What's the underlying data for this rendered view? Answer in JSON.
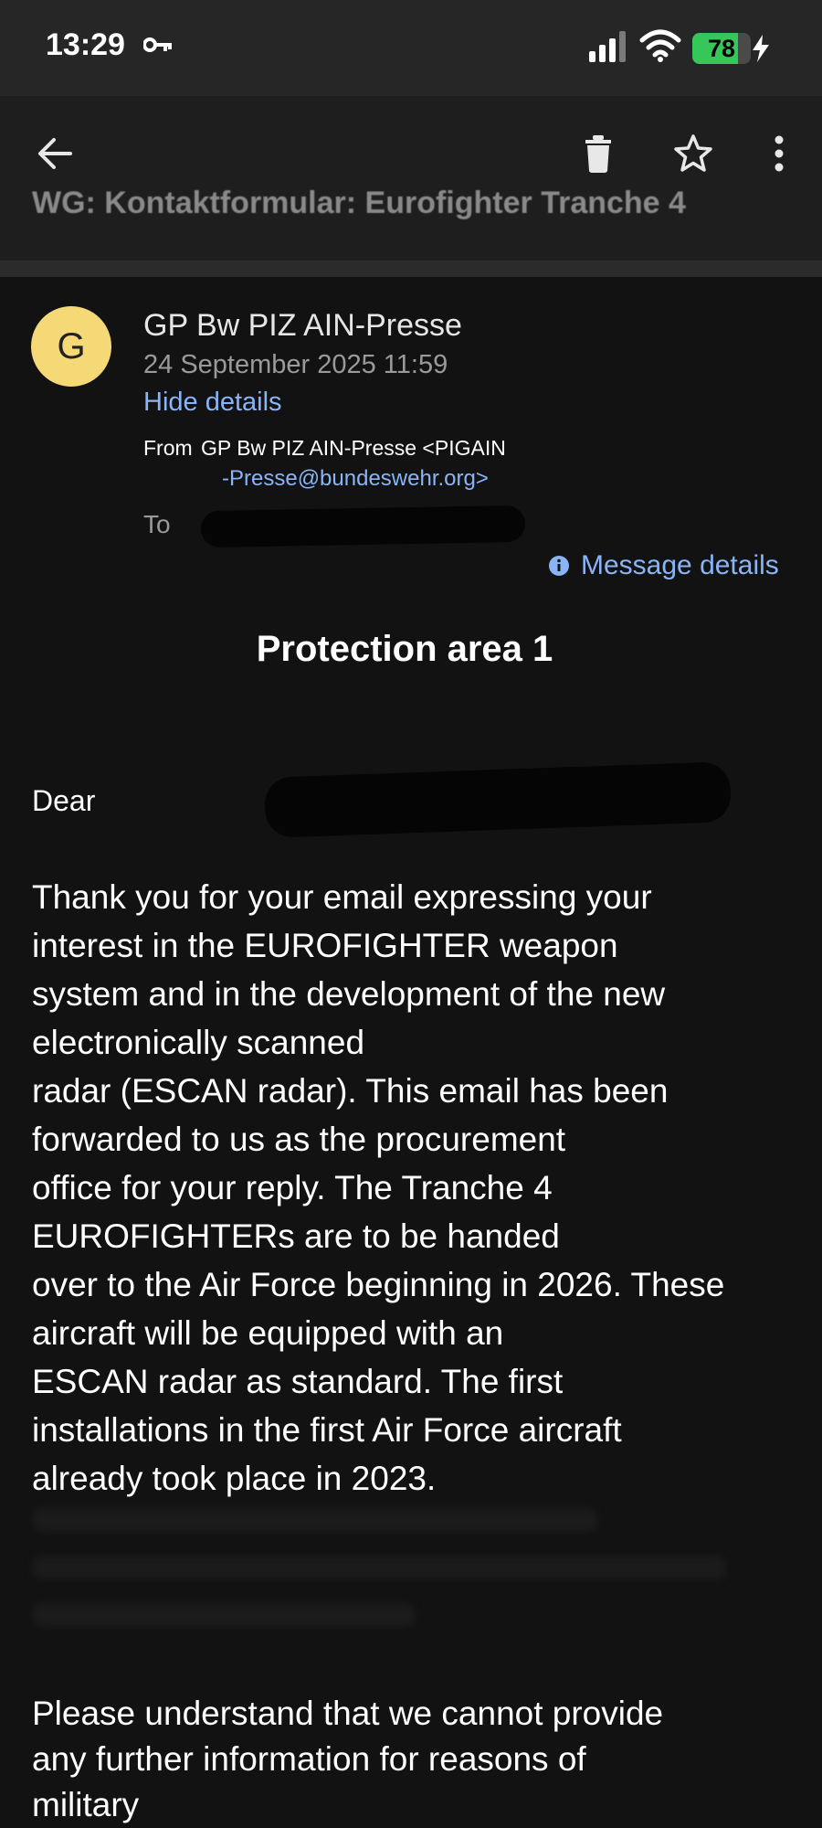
{
  "status_bar": {
    "time": "13:29",
    "battery_level": 78,
    "battery_text": "78",
    "icons": [
      "key-icon",
      "signal-icon",
      "wifi-icon",
      "battery-icon",
      "charging-bolt-icon"
    ]
  },
  "toolbar": {
    "icons": [
      "back-arrow-icon",
      "trash-icon",
      "star-icon",
      "more-vert-icon"
    ]
  },
  "email": {
    "subject": "WG: Kontaktformular: Eurofighter Tranche 4",
    "sender_initial": "G",
    "sender_name": "GP Bw PIZ AIN-Presse",
    "date": "24 September 2025 11:59",
    "hide_details": "Hide details",
    "from_label": "From",
    "from_name": "GP Bw PIZ AIN-Presse <PIGAIN",
    "from_email": "-Presse@bundeswehr.org>",
    "to_label": "To",
    "message_details": "Message details",
    "protection_title": "Protection area 1",
    "greeting": "Dear",
    "body_lines": [
      "Thank you for your email expressing your",
      "interest in the EUROFIGHTER weapon",
      "system and in the development of the new",
      "electronically scanned",
      "radar (ESCAN radar). This email has been",
      "forwarded to us as the procurement",
      "office for your reply. The Tranche 4",
      "EUROFIGHTERs are to be handed",
      "over to the Air Force beginning in 2026. These",
      "aircraft will be equipped with an",
      "ESCAN radar as standard. The first",
      "installations in the first Air Force aircraft",
      "already took place in 2023."
    ],
    "closing_lines": [
      "Please understand that we cannot provide",
      "any further information for reasons of",
      "military"
    ]
  },
  "colors": {
    "background": "#121212",
    "toolbar": "#1e1e1e",
    "status_bar": "#262626",
    "link": "#8ab4f8",
    "avatar": "#f6d977",
    "battery": "#35c759"
  }
}
